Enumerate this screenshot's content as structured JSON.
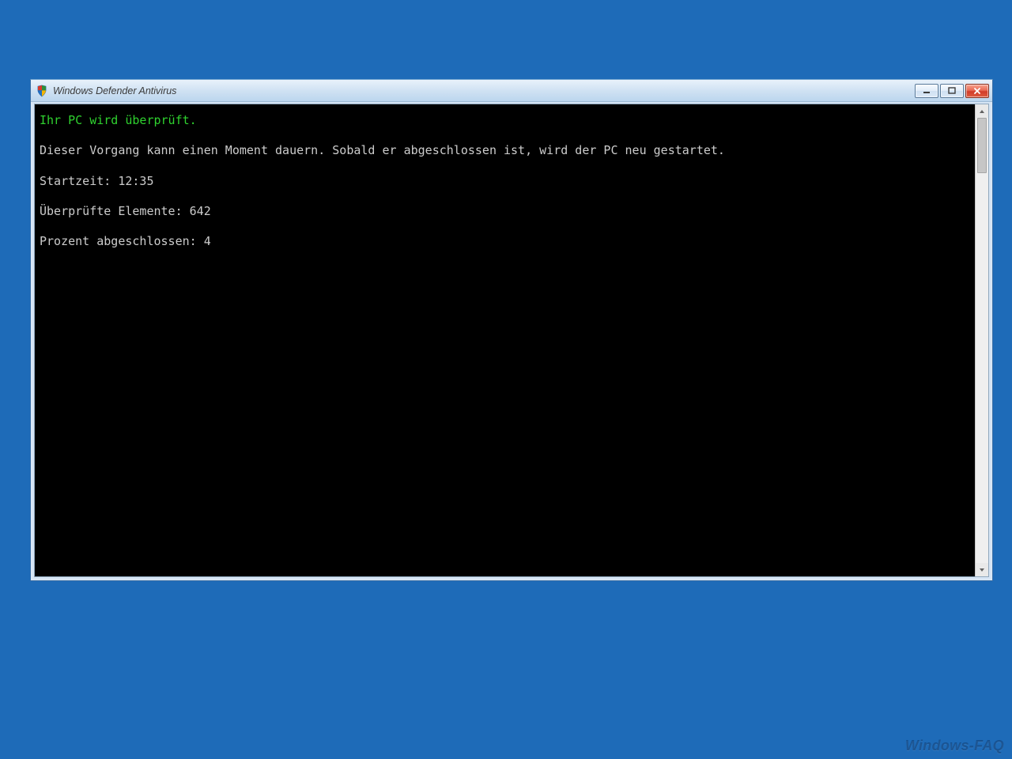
{
  "window": {
    "title": "Windows Defender Antivirus"
  },
  "console": {
    "heading": "Ihr PC wird überprüft.",
    "info": "Dieser Vorgang kann einen Moment dauern. Sobald er abgeschlossen ist, wird der PC neu gestartet.",
    "start_time_label": "Startzeit:",
    "start_time_value": "12:35",
    "items_label": "Überprüfte Elemente:",
    "items_value": "642",
    "percent_label": "Prozent abgeschlossen:",
    "percent_value": "4"
  },
  "watermark": "Windows-FAQ"
}
